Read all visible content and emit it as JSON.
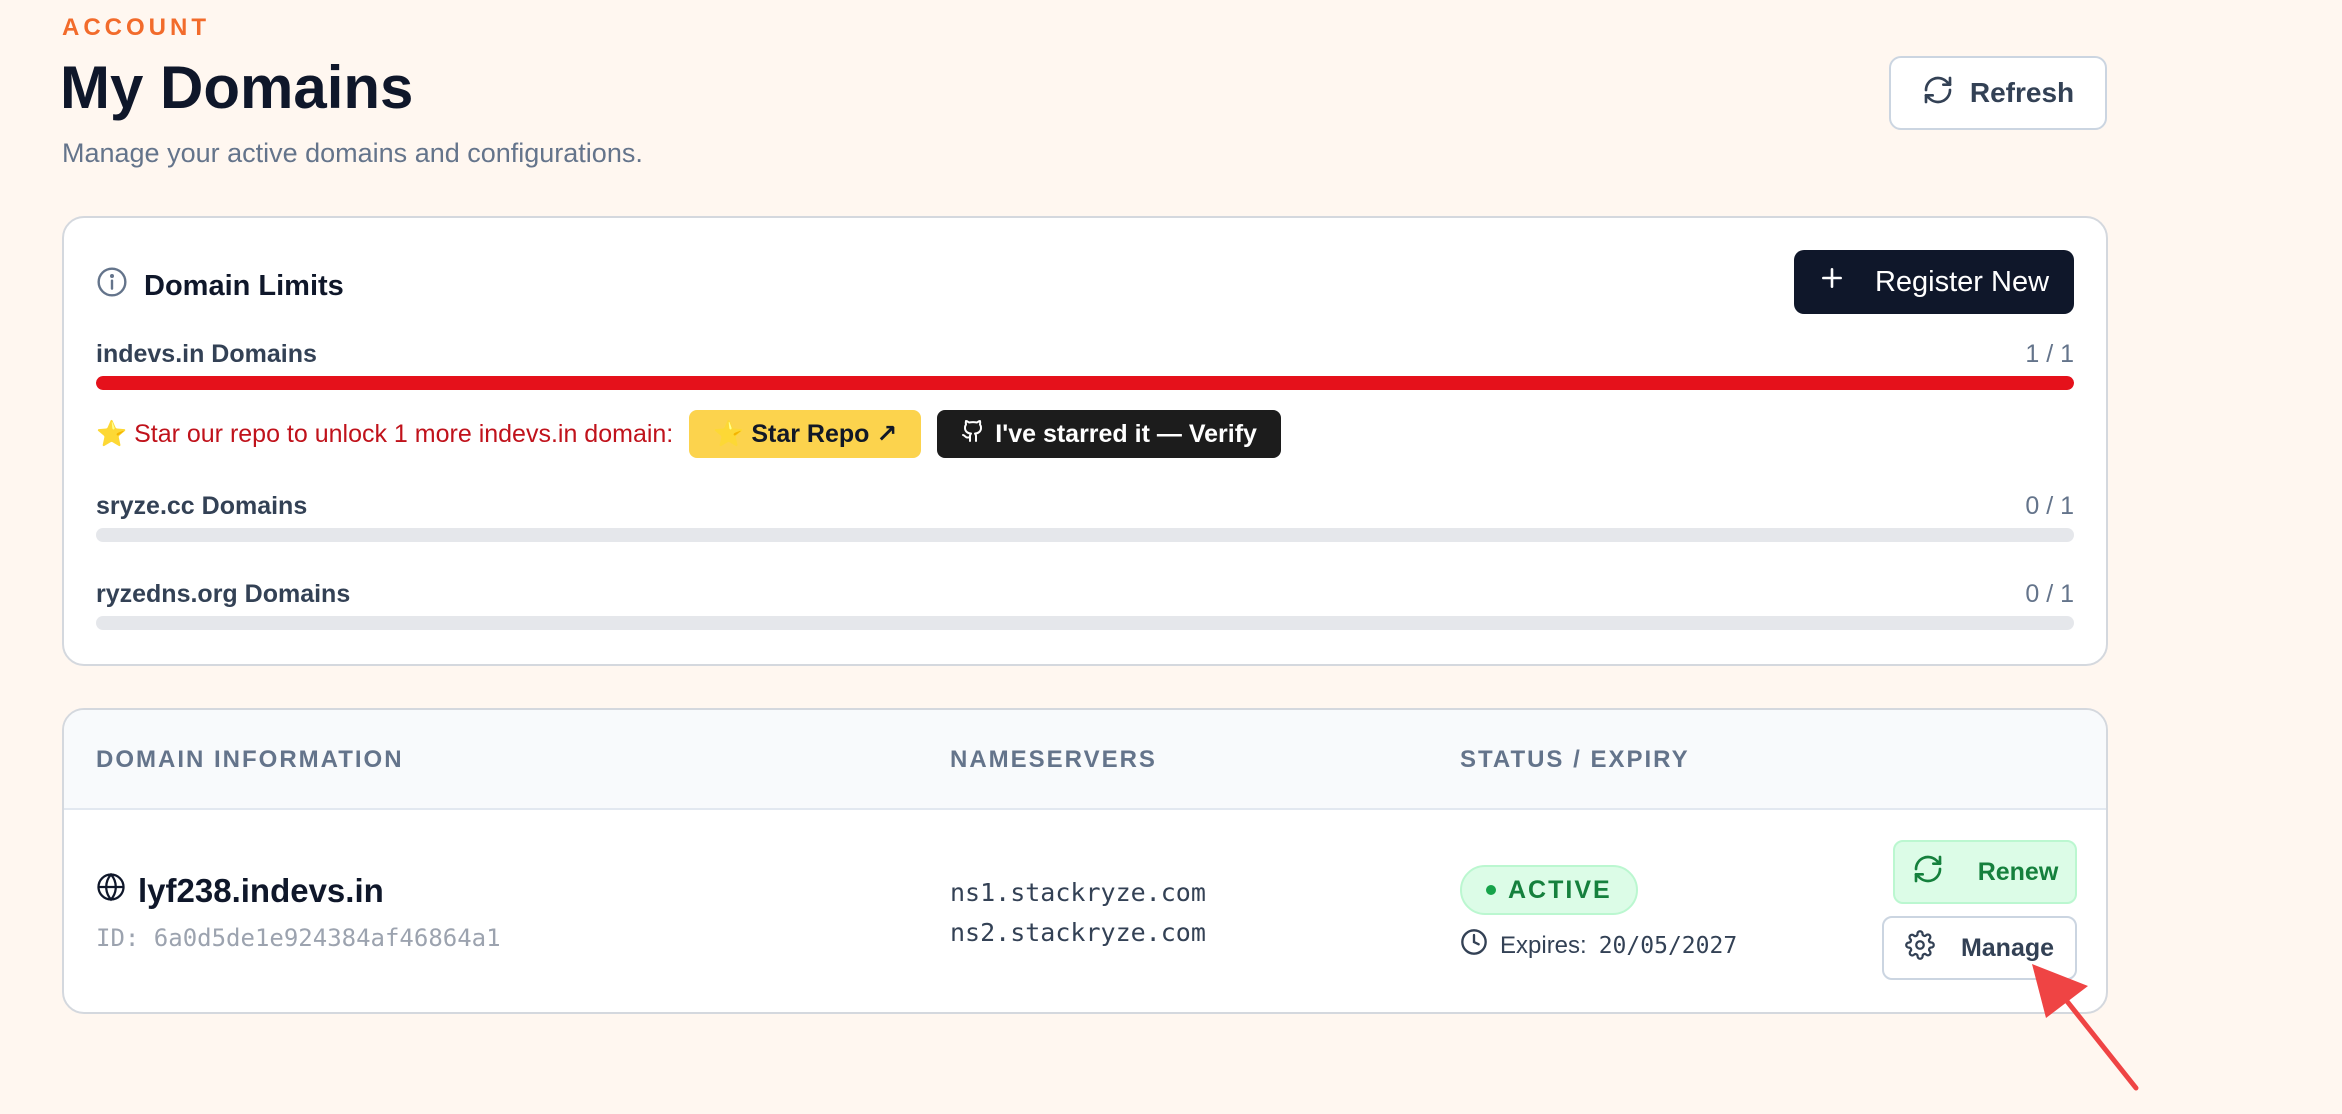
{
  "header": {
    "eyebrow": "ACCOUNT",
    "title": "My Domains",
    "subtitle": "Manage your active domains and configurations.",
    "refresh_label": "Refresh"
  },
  "limits": {
    "title": "Domain Limits",
    "register_label": "Register New",
    "items": [
      {
        "label": "indevs.in Domains",
        "count": "1 / 1",
        "fill": 1.0,
        "color": "#e5111b"
      },
      {
        "label": "sryze.cc Domains",
        "count": "0 / 1",
        "fill": 0.0,
        "color": "#e5e7eb"
      },
      {
        "label": "ryzedns.org Domains",
        "count": "0 / 1",
        "fill": 0.0,
        "color": "#e5e7eb"
      }
    ],
    "promo": {
      "text": "⭐ Star our repo to unlock 1 more indevs.in domain:",
      "star_label": "⭐ Star Repo ↗",
      "verify_label": "I've starred it — Verify"
    }
  },
  "table": {
    "headers": [
      "DOMAIN INFORMATION",
      "NAMESERVERS",
      "STATUS / EXPIRY"
    ],
    "rows": [
      {
        "domain": "lyf238.indevs.in",
        "id": "ID: 6a0d5de1e924384af46864a1",
        "nameservers": [
          "ns1.stackryze.com",
          "ns2.stackryze.com"
        ],
        "status": "ACTIVE",
        "expires_label": "Expires:",
        "expires_date": "20/05/2027",
        "renew_label": "Renew",
        "manage_label": "Manage"
      }
    ]
  },
  "colors": {
    "accent": "#f26b2b",
    "danger": "#e5111b",
    "success": "#15803d",
    "dark": "#0f172a"
  }
}
